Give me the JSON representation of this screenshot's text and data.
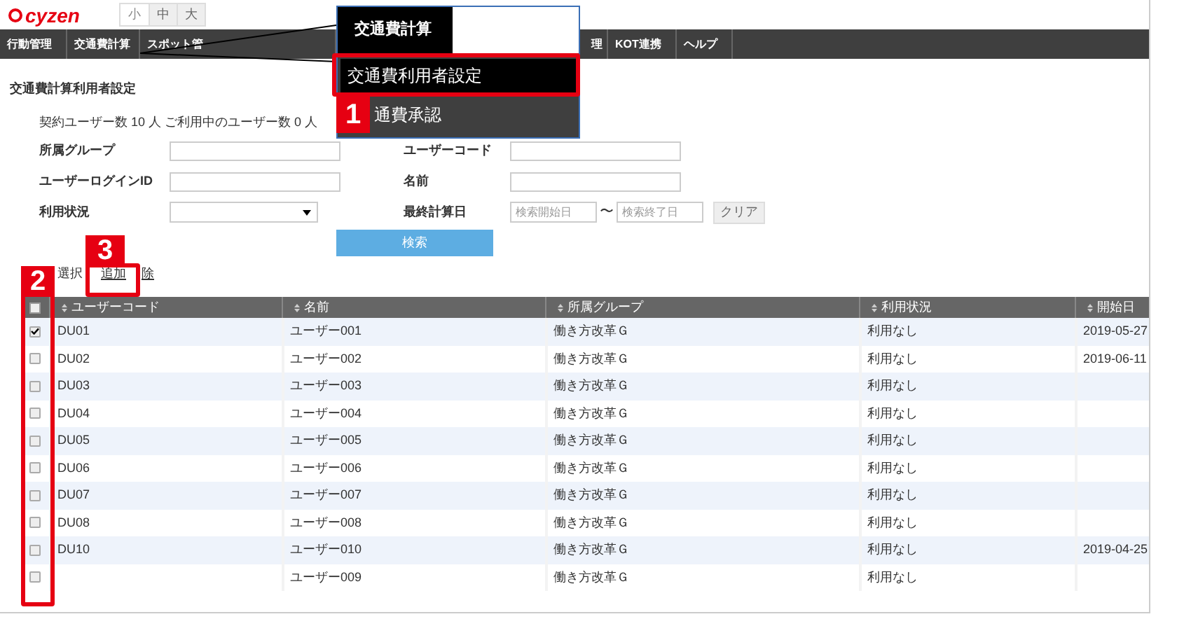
{
  "header": {
    "logo": "cyzen",
    "font_sizes": [
      {
        "label": "小",
        "selected": true
      },
      {
        "label": "中",
        "selected": false
      },
      {
        "label": "大",
        "selected": false
      }
    ]
  },
  "nav": [
    "行動管理",
    "交通費計算",
    "スポット管",
    "理",
    "KOT連携",
    "ヘルプ"
  ],
  "page_title": "交通費計算利用者設定",
  "contract_text": "契約ユーザー数 10 人 ご利用中のユーザー数 0 人",
  "filters_left": [
    {
      "label": "所属グループ",
      "kind": "text"
    },
    {
      "label": "ユーザーログインID",
      "kind": "text"
    },
    {
      "label": "利用状況",
      "kind": "select"
    }
  ],
  "filters_right": [
    {
      "label": "ユーザーコード",
      "kind": "text"
    },
    {
      "label": "名前",
      "kind": "text"
    },
    {
      "label": "最終計算日",
      "kind": "daterange",
      "from_placeholder": "検索開始日",
      "separator": "〜",
      "to_placeholder": "検索終了日",
      "clear": "クリア"
    }
  ],
  "search_button": "検索",
  "selection_links": [
    "選択",
    "追加",
    "除"
  ],
  "table": {
    "select_all": {
      "checked": false
    },
    "columns": [
      "ユーザーコード",
      "名前",
      "所属グループ",
      "利用状況",
      "開始日"
    ],
    "rows": [
      {
        "checked": true,
        "cells": [
          "DU01",
          "ユーザー001",
          "働き方改革Ｇ",
          "利用なし",
          "2019-05-27"
        ]
      },
      {
        "checked": false,
        "cells": [
          "DU02",
          "ユーザー002",
          "働き方改革Ｇ",
          "利用なし",
          "2019-06-11"
        ]
      },
      {
        "checked": false,
        "cells": [
          "DU03",
          "ユーザー003",
          "働き方改革Ｇ",
          "利用なし",
          ""
        ]
      },
      {
        "checked": false,
        "cells": [
          "DU04",
          "ユーザー004",
          "働き方改革Ｇ",
          "利用なし",
          ""
        ]
      },
      {
        "checked": false,
        "cells": [
          "DU05",
          "ユーザー005",
          "働き方改革Ｇ",
          "利用なし",
          ""
        ]
      },
      {
        "checked": false,
        "cells": [
          "DU06",
          "ユーザー006",
          "働き方改革Ｇ",
          "利用なし",
          ""
        ]
      },
      {
        "checked": false,
        "cells": [
          "DU07",
          "ユーザー007",
          "働き方改革Ｇ",
          "利用なし",
          ""
        ]
      },
      {
        "checked": false,
        "cells": [
          "DU08",
          "ユーザー008",
          "働き方改革Ｇ",
          "利用なし",
          ""
        ]
      },
      {
        "checked": false,
        "cells": [
          "DU10",
          "ユーザー010",
          "働き方改革Ｇ",
          "利用なし",
          "2019-04-25"
        ]
      },
      {
        "checked": false,
        "cells": [
          "",
          "ユーザー009",
          "働き方改革Ｇ",
          "利用なし",
          ""
        ]
      }
    ]
  },
  "zoomed_menu": {
    "title": "交通費計算",
    "items": [
      {
        "label": "交通費利用者設定",
        "selected": true
      },
      {
        "label": "通費承認",
        "selected": false
      }
    ]
  },
  "callouts": [
    "1",
    "2",
    "3"
  ]
}
